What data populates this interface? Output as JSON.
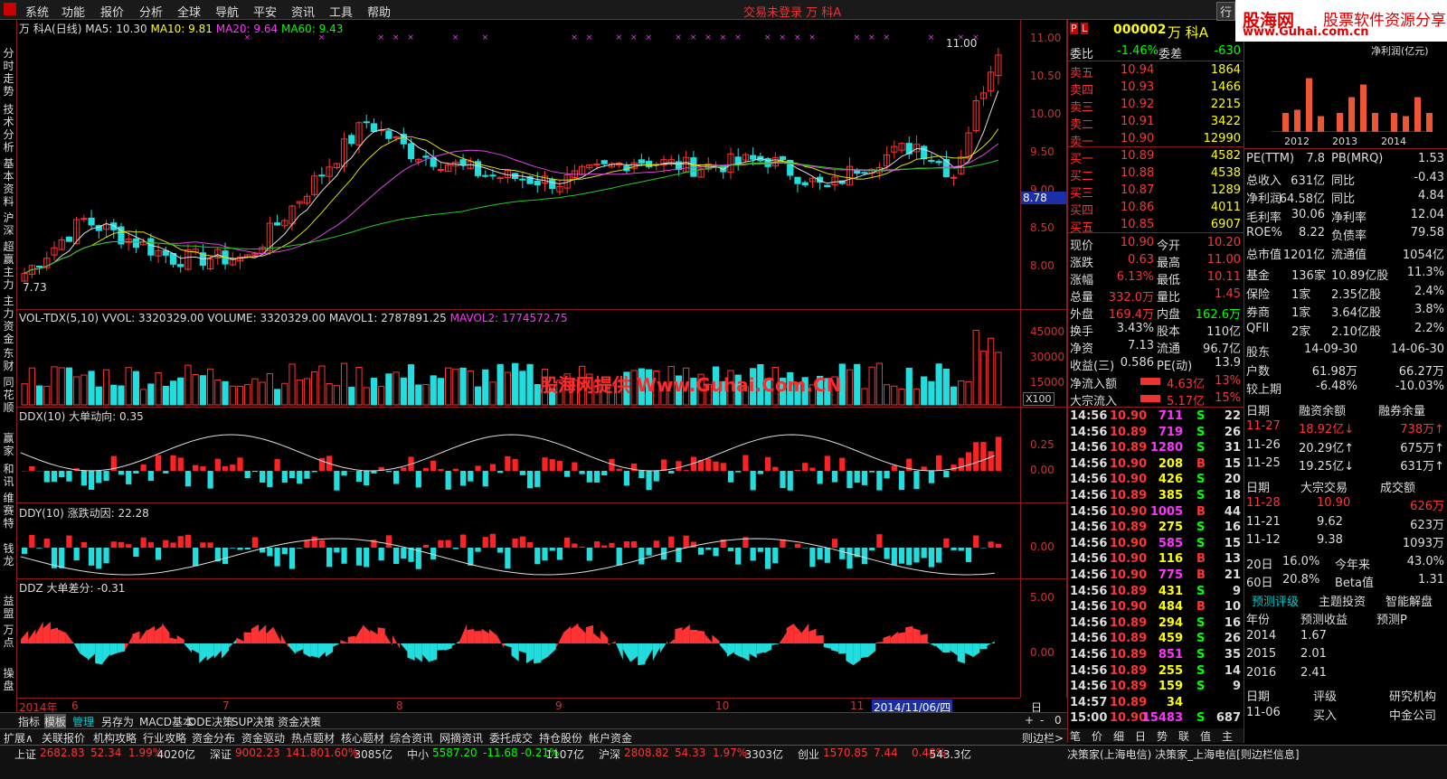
{
  "menu": {
    "items": [
      "系统",
      "功能",
      "报价",
      "分析",
      "全球",
      "导航",
      "平安",
      "资讯",
      "工具",
      "帮助"
    ],
    "warning": "交易未登录 万 科A",
    "right_btn": "行"
  },
  "brand": {
    "b1": "股海网",
    "b2": "股票软件资源分享",
    "b3": "www.Guhai.com.cn"
  },
  "leftnav": [
    "分时走势",
    "技术分析",
    "基本资料",
    "沪深",
    "超赢主力",
    "主力资金",
    "东财",
    "同花顺",
    "赢家",
    "和讯",
    "维赛特",
    "钱龙",
    "益盟",
    "万点",
    "操盘"
  ],
  "chart": {
    "title": "万 科A(日线)",
    "ma5": "MA5: 10.30",
    "ma10": "MA10: 9.81",
    "ma20": "MA20: 9.64",
    "ma60": "MA60: 9.43",
    "high_label": "11.00",
    "low_label": "7.73",
    "price_tag": "8.78",
    "vol_head": "VOL-TDX(5,10) VVOL: 3320329.00  VOLUME: 3320329.00  MAVOL1: 2787891.25",
    "vol_mavol2": "MAVOL2: 1774572.75",
    "watermark": "股海网提供 Www.Guhai.Com.CN",
    "ddx_head": "DDX(10)  大单动向: 0.35",
    "ddy_head": "DDY(10)  涨跌动因: 22.28",
    "ddz_head": "DDZ  大单差分: -0.31",
    "price_ticks": [
      "11.00",
      "10.50",
      "10.00",
      "9.50",
      "9.00",
      "8.50",
      "8.00"
    ],
    "vol_ticks": [
      "45000",
      "30000",
      "15000"
    ],
    "vol_unit": "X100",
    "ddx_ticks": [
      "0.25",
      "0.00"
    ],
    "ddy_ticks": [
      "0.00"
    ],
    "ddz_ticks": [
      "5.00",
      "0.00"
    ],
    "x_labels": [
      "2014年",
      "6",
      "7",
      "8",
      "9",
      "10",
      "11"
    ],
    "x_cursor": "2014/11/06/四",
    "period": "日线"
  },
  "tabs1": [
    "指标",
    "模板",
    "管理",
    "另存为",
    "MACD基本",
    "DDE决策",
    "SUP决策",
    "资金决策"
  ],
  "tabs2": [
    "扩展∧",
    "关联报价",
    "机构攻略",
    "行业攻略",
    "资金分布",
    "资金驱动",
    "热点题材",
    "核心题材",
    "综合资讯",
    "网摘资讯",
    "委托成交",
    "持仓股份",
    "帐户资金"
  ],
  "zoom": [
    "+",
    "-",
    "0"
  ],
  "side_tab": "则边栏>",
  "quote": {
    "code": "000002",
    "name": "万 科A",
    "weibi_label": "委比",
    "weibi": "-1.46%",
    "weicha_label": "委差",
    "weicha": "-630",
    "sells": [
      [
        "卖五",
        "10.94",
        "1864"
      ],
      [
        "卖四",
        "10.93",
        "1466"
      ],
      [
        "卖三",
        "10.92",
        "2215"
      ],
      [
        "卖二",
        "10.91",
        "3422"
      ],
      [
        "卖一",
        "10.90",
        "12990"
      ]
    ],
    "buys": [
      [
        "买一",
        "10.89",
        "4582"
      ],
      [
        "买二",
        "10.88",
        "4538"
      ],
      [
        "买三",
        "10.87",
        "1289"
      ],
      [
        "买四",
        "10.86",
        "4011"
      ],
      [
        "买五",
        "10.85",
        "6907"
      ]
    ],
    "stats": [
      [
        "现价",
        "10.90",
        "今开",
        "10.20"
      ],
      [
        "涨跌",
        "0.63",
        "最高",
        "11.00"
      ],
      [
        "涨幅",
        "6.13%",
        "最低",
        "10.11"
      ],
      [
        "总量",
        "332.0万",
        "量比",
        "1.45"
      ],
      [
        "外盘",
        "169.4万",
        "内盘",
        "162.6万"
      ],
      [
        "换手",
        "3.43%",
        "股本",
        "110亿"
      ],
      [
        "净资",
        "7.13",
        "流通",
        "96.7亿"
      ],
      [
        "收益(三)",
        "0.586",
        "PE(动)",
        "13.9"
      ]
    ],
    "flows": [
      [
        "净流入额",
        "4.63亿",
        "13%"
      ],
      [
        "大宗流入",
        "5.17亿",
        "15%"
      ]
    ],
    "ticks": [
      [
        "14:56",
        "10.90",
        "711",
        "S",
        "22"
      ],
      [
        "14:56",
        "10.89",
        "719",
        "S",
        "26"
      ],
      [
        "14:56",
        "10.89",
        "1280",
        "S",
        "31"
      ],
      [
        "14:56",
        "10.90",
        "208",
        "B",
        "15"
      ],
      [
        "14:56",
        "10.90",
        "426",
        "S",
        "20"
      ],
      [
        "14:56",
        "10.89",
        "385",
        "S",
        "18"
      ],
      [
        "14:56",
        "10.90",
        "1005",
        "B",
        "44"
      ],
      [
        "14:56",
        "10.89",
        "275",
        "S",
        "16"
      ],
      [
        "14:56",
        "10.90",
        "585",
        "S",
        "15"
      ],
      [
        "14:56",
        "10.90",
        "116",
        "B",
        "13"
      ],
      [
        "14:56",
        "10.90",
        "775",
        "B",
        "21"
      ],
      [
        "14:56",
        "10.89",
        "431",
        "S",
        "9"
      ],
      [
        "14:56",
        "10.90",
        "484",
        "B",
        "10"
      ],
      [
        "14:56",
        "10.89",
        "294",
        "S",
        "16"
      ],
      [
        "14:56",
        "10.89",
        "459",
        "S",
        "26"
      ],
      [
        "14:56",
        "10.89",
        "851",
        "S",
        "35"
      ],
      [
        "14:56",
        "10.89",
        "255",
        "S",
        "14"
      ],
      [
        "14:56",
        "10.89",
        "159",
        "S",
        "9"
      ],
      [
        "14:57",
        "10.89",
        "34",
        "",
        ""
      ],
      [
        "15:00",
        "10.90",
        "15483",
        "S",
        "687"
      ]
    ],
    "tabs": [
      "笔",
      "价",
      "细",
      "日",
      "势",
      "联",
      "值",
      "主"
    ]
  },
  "fund": {
    "years": [
      "2012",
      "2013",
      "2014"
    ],
    "bar_title": "净利润(亿元)",
    "rows1": [
      [
        "PE(TTM)",
        "7.8",
        "PB(MRQ)",
        "1.53"
      ],
      [
        "总收入",
        "631亿",
        "同比",
        "-0.43"
      ],
      [
        "净利润",
        "64.58亿",
        "同比",
        "4.84"
      ],
      [
        "毛利率",
        "30.06",
        "净利率",
        "12.04"
      ],
      [
        "ROE%",
        "8.22",
        "负债率",
        "79.58"
      ],
      [
        "总市值",
        "1201亿",
        "流通值",
        "1054亿"
      ]
    ],
    "inst": [
      [
        "基金",
        "136家",
        "10.89亿股",
        "11.3%"
      ],
      [
        "保险",
        "1家",
        "2.35亿股",
        "2.4%"
      ],
      [
        "券商",
        "1家",
        "3.64亿股",
        "3.8%"
      ],
      [
        "QFII",
        "2家",
        "2.10亿股",
        "2.2%"
      ]
    ],
    "holders": [
      [
        "股东",
        "14-09-30",
        "14-06-30"
      ],
      [
        "户数",
        "61.98万",
        "66.27万"
      ],
      [
        "较上期",
        "-6.48%",
        "-10.03%"
      ]
    ],
    "margin_head": [
      "日期",
      "融资余额",
      "融券余量"
    ],
    "margin": [
      [
        "11-27",
        "18.92亿↓",
        "738万↑"
      ],
      [
        "11-26",
        "20.29亿↑",
        "675万↑"
      ],
      [
        "11-25",
        "19.25亿↓",
        "631万↑"
      ]
    ],
    "block_head": [
      "日期",
      "大宗交易",
      "成交额"
    ],
    "block": [
      [
        "11-28",
        "10.90",
        "626万"
      ],
      [
        "11-21",
        "9.62",
        "623万"
      ],
      [
        "11-12",
        "9.38",
        "1093万"
      ]
    ],
    "perf": [
      [
        "20日",
        "16.0%",
        "今年来",
        "43.0%"
      ],
      [
        "60日",
        "20.8%",
        "Beta值",
        "1.31"
      ]
    ],
    "ftabs": [
      "预测评级",
      "主题投资",
      "智能解盘"
    ],
    "fc_head": [
      "年份",
      "预测收益",
      "预测P"
    ],
    "fc": [
      [
        "2014",
        "1.67"
      ],
      [
        "2015",
        "2.01"
      ],
      [
        "2016",
        "2.41"
      ]
    ],
    "rating_head": [
      "日期",
      "评级",
      "研究机构"
    ],
    "rating": [
      [
        "11-06",
        "买入",
        "中金公司"
      ]
    ]
  },
  "status": {
    "items": [
      [
        "上证",
        "2682.83",
        "52.34",
        "1.99%",
        "4020亿"
      ],
      [
        "深证",
        "9002.23",
        "141.80",
        "1.60%",
        "3085亿"
      ],
      [
        "中小",
        "5587.20",
        "-11.68",
        "-0.21%",
        "1107亿"
      ],
      [
        "沪深",
        "2808.82",
        "54.33",
        "1.97%",
        "3303亿"
      ],
      [
        "创业",
        "1570.85",
        "7.44",
        "0.48%",
        "543.3亿"
      ]
    ],
    "right": "决策家(上海电信)  决策家_上海电信[则边栏信息]"
  },
  "colors": {
    "up": "#ff3333",
    "down": "#22dddd",
    "border": "#8b1a1a"
  }
}
